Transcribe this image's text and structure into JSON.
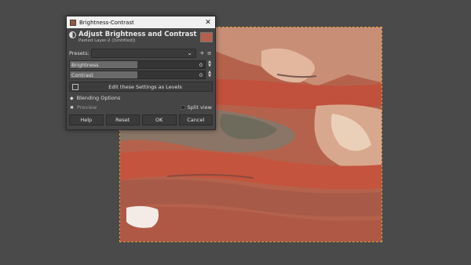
{
  "dialog": {
    "window_title": "Brightness-Contrast",
    "header_title": "Adjust Brightness and Contrast",
    "header_subtitle": "Pasted Layer-2 ([Untitled])",
    "presets_label": "Presets:",
    "presets_value": "",
    "brightness": {
      "label": "Brightness",
      "value": "0",
      "fill_fraction": 0.5
    },
    "contrast": {
      "label": "Contrast",
      "value": "0",
      "fill_fraction": 0.5
    },
    "levels_button": "Edit these Settings as Levels",
    "blending_options": "Blending Options",
    "preview_label": "Preview",
    "split_view_label": "Split view",
    "buttons": {
      "help": "Help",
      "reset": "Reset",
      "ok": "OK",
      "cancel": "Cancel"
    }
  },
  "icons": {
    "app": "gimp-icon",
    "close": "close-icon",
    "brightness_contrast": "brightness-contrast-icon",
    "add_preset": "plus-icon",
    "preset_menu": "menu-icon"
  },
  "colors": {
    "workspace": "#4a4a4a",
    "dialog_bg": "#454545",
    "image_base": "#b55a45",
    "selection_border": "#e0a03a"
  }
}
